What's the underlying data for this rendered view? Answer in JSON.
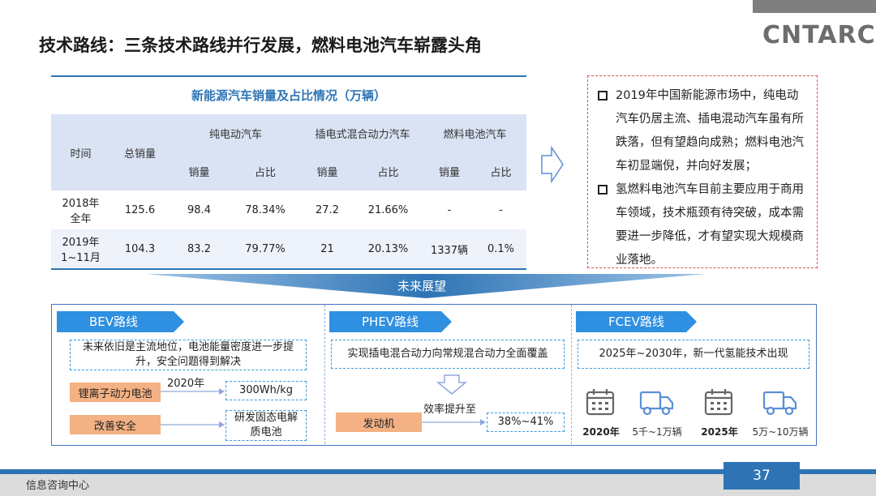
{
  "header": {
    "logo": "CNTARC",
    "title": "技术路线：三条技术路线并行发展，燃料电池汽车崭露头角"
  },
  "table": {
    "caption": "新能源汽车销量及占比情况（万辆）",
    "col_time": "时间",
    "col_total": "总销量",
    "groups": [
      "纯电动汽车",
      "插电式混合动力汽车",
      "燃料电池汽车"
    ],
    "sub_sales": "销量",
    "sub_share": "占比",
    "rows": [
      {
        "year": "2018年",
        "period": "全年",
        "total": "125.6",
        "bev_sales": "98.4",
        "bev_share": "78.34%",
        "phev_sales": "27.2",
        "phev_share": "21.66%",
        "fcev_sales": "-",
        "fcev_share": "-"
      },
      {
        "year": "2019年",
        "period": "1~11月",
        "total": "104.3",
        "bev_sales": "83.2",
        "bev_share": "79.77%",
        "phev_sales": "21",
        "phev_share": "20.13%",
        "fcev_sales": "1337辆",
        "fcev_share": "0.1%"
      }
    ]
  },
  "bullets": [
    "2019年中国新能源市场中，纯电动汽车仍居主流、插电混动汽车虽有所跌落，但有望趋向成熟；燃料电池汽车初显端倪，并向好发展；",
    "氢燃料电池汽车目前主要应用于商用车领域，技术瓶颈有待突破，成本需要进一步降低，才有望实现大规模商业落地。"
  ],
  "future_label": "未来展望",
  "bev": {
    "tag": "BEV路线",
    "desc": "未来依旧是主流地位，电池能量密度进一步提升，安全问题得到解决",
    "item1_label": "锂离子动力电池",
    "item1_year": "2020年",
    "item1_value": "300Wh/kg",
    "item2_label": "改善安全",
    "item2_value": "研发固态电解质电池"
  },
  "phev": {
    "tag": "PHEV路线",
    "desc": "实现插电混合动力向常规混合动力全面覆盖",
    "item_label": "发动机",
    "item_note": "效率提升至",
    "item_value": "38%~41%"
  },
  "fcev": {
    "tag": "FCEV路线",
    "desc": "2025年~2030年，新一代氢能技术出现",
    "milestones": [
      {
        "year": "2020年",
        "vehicles": "5千~1万辆"
      },
      {
        "year": "2025年",
        "vehicles": "5万~10万辆"
      }
    ]
  },
  "footer": {
    "org": "信息咨询中心",
    "page": "37"
  },
  "colors": {
    "accent_blue": "#2e74b5",
    "tag_blue": "#2f8fe0",
    "orange": "#f4b183",
    "dashed_red": "#d9534f"
  }
}
